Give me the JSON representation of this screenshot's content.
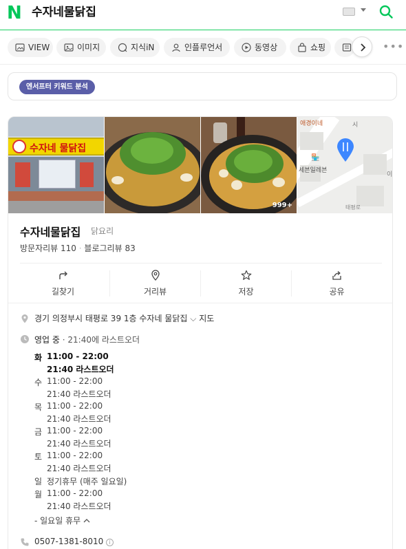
{
  "header": {
    "query": "수자네물닭집"
  },
  "tabs": [
    {
      "label": "VIEW",
      "icon": "image-icon"
    },
    {
      "label": "이미지",
      "icon": "image-icon"
    },
    {
      "label": "지식iN",
      "icon": "question-icon"
    },
    {
      "label": "인플루언서",
      "icon": "person-icon"
    },
    {
      "label": "동영상",
      "icon": "play-icon"
    },
    {
      "label": "쇼핑",
      "icon": "bag-icon"
    }
  ],
  "keyword_chip": "엔서프터 키워드 분석",
  "place": {
    "name": "수자네물닭집",
    "category": "닭요리",
    "visit_reviews_label": "방문자리뷰",
    "visit_reviews_count": "110",
    "blog_reviews_label": "블로그리뷰",
    "blog_reviews_count": "83",
    "photo_count_badge": "999+",
    "photo_sign_text": "수자네 물닭집",
    "map_labels": [
      "애경이네",
      "세븐일레븐",
      "이",
      "시",
      "태평로"
    ],
    "actions": [
      {
        "label": "길찾기",
        "icon": "directions-icon"
      },
      {
        "label": "거리뷰",
        "icon": "map-pin-icon"
      },
      {
        "label": "저장",
        "icon": "star-icon"
      },
      {
        "label": "공유",
        "icon": "share-icon"
      }
    ],
    "address": "경기 의정부시 태평로 39 1층 수자네 물닭집",
    "map_link": "지도",
    "status": "영업 중",
    "status_detail": "· 21:40에 라스트오더",
    "hours": [
      {
        "day": "화",
        "time": "11:00 - 22:00",
        "last_order": "21:40 라스트오더",
        "today": true
      },
      {
        "day": "수",
        "time": "11:00 - 22:00",
        "last_order": "21:40 라스트오더"
      },
      {
        "day": "목",
        "time": "11:00 - 22:00",
        "last_order": "21:40 라스트오더"
      },
      {
        "day": "금",
        "time": "11:00 - 22:00",
        "last_order": "21:40 라스트오더"
      },
      {
        "day": "토",
        "time": "11:00 - 22:00",
        "last_order": "21:40 라스트오더"
      },
      {
        "day": "일",
        "time": "정기휴무 (매주 일요일)",
        "last_order": ""
      },
      {
        "day": "월",
        "time": "11:00 - 22:00",
        "last_order": "21:40 라스트오더"
      }
    ],
    "closed_note": "- 일요일 휴무",
    "phone": "0507-1381-8010"
  },
  "colors": {
    "naver_green": "#03c75a",
    "chip_purple": "#5a5ea8"
  }
}
